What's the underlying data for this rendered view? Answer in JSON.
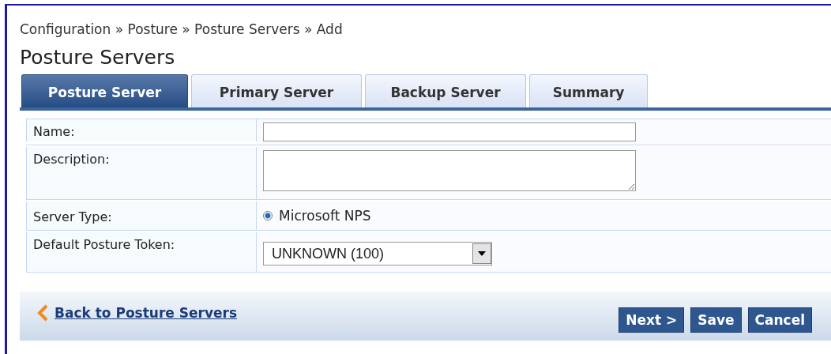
{
  "breadcrumb": "Configuration » Posture » Posture Servers » Add",
  "page_title": "Posture Servers",
  "tabs": [
    {
      "label": "Posture Server",
      "selected": true
    },
    {
      "label": "Primary Server",
      "selected": false
    },
    {
      "label": "Backup Server",
      "selected": false
    },
    {
      "label": "Summary",
      "selected": false
    }
  ],
  "form": [
    {
      "kind": "text",
      "label": "Name:"
    },
    {
      "kind": "textarea",
      "label": "Description:"
    },
    {
      "kind": "radio",
      "label": "Server Type:",
      "option": "Microsoft NPS",
      "checked": true
    },
    {
      "kind": "select",
      "label": "Default Posture Token:",
      "value": "UNKNOWN (100)"
    }
  ],
  "back_link": "Back to Posture Servers",
  "buttons": [
    "Next >",
    "Save",
    "Cancel"
  ]
}
